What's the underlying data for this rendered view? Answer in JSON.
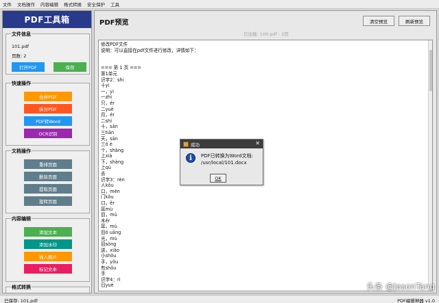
{
  "menu": [
    "文件",
    "文档操作",
    "内容编辑",
    "格式转换",
    "安全保护",
    "工具"
  ],
  "sidebar": {
    "title": "PDF工具箱",
    "file_info": {
      "label": "文件信息",
      "filename": "101.pdf",
      "pages": "页数: 2",
      "open_label": "打开PDF",
      "save_label": "保存"
    },
    "quick": {
      "label": "快速操作",
      "buttons": [
        "合并PDF",
        "拆分PDF",
        "PDF转Word",
        "OCR识别"
      ]
    },
    "doc_ops": {
      "label": "文档操作",
      "buttons": [
        "重排页面",
        "删除页面",
        "提取页面",
        "旋转页面"
      ]
    },
    "content_edit": {
      "label": "内容编辑",
      "buttons": [
        "添加文本",
        "添加水印",
        "插入图片",
        "标记文本"
      ]
    },
    "format": {
      "label": "格式转换"
    }
  },
  "main": {
    "title": "PDF预览",
    "clear_label": "清空预览",
    "refresh_label": "刷新预览",
    "loaded_text": "已加载: 100.pdf - 2页",
    "lines": [
      "修改PDF文件",
      "说明：可以直接在pdf文件进行修改，详情如下：",
      "",
      "",
      "=== 第 1 页 ===",
      "第1单元",
      "识字2：shi",
      "十yi",
      "一，yi",
      "一zhì",
      "只，ér",
      "二yuè",
      "月，ér",
      "二shí",
      "十，sān",
      "三tiān",
      "天，sān",
      "三ǒ è",
      "个，shàng",
      "上xià",
      "下，shàng",
      "上qù",
      "去",
      "识字3：rén",
      "人kǒu",
      "口，mén",
      "门kǒu",
      "口，ěr",
      "耳mù",
      "目，mù",
      "木ěr",
      "耳，mù",
      "目ǒ uānɡ",
      "光，mù",
      "目sònɡ",
      "送，xiǎo",
      "小shǒu",
      "手，yǒu",
      "有shǒu",
      "手",
      "识字4：rì",
      "日yuè"
    ]
  },
  "dialog": {
    "title": "成功",
    "message_line1": "PDF已转换为Word文档:",
    "message_line2": "/usr/local/101.docx",
    "ok_label": "OK",
    "close_glyph": "✕",
    "info_glyph": "i"
  },
  "status": {
    "left": "已保存: 101.pdf",
    "right": "PDF编辑神器 v1.0"
  },
  "watermark": "头条 @JasonTang",
  "colors": {
    "sidebar_title_bg": "#283a8c",
    "blue_btn": "#2196f3",
    "green_btn": "#4caf50",
    "orange_btn": "#ff9800",
    "red_orange_btn": "#ff5722",
    "purple_btn": "#9c27b0",
    "slate_btn": "#607d8b",
    "teal_btn": "#009688",
    "pink_btn": "#e91e63"
  }
}
